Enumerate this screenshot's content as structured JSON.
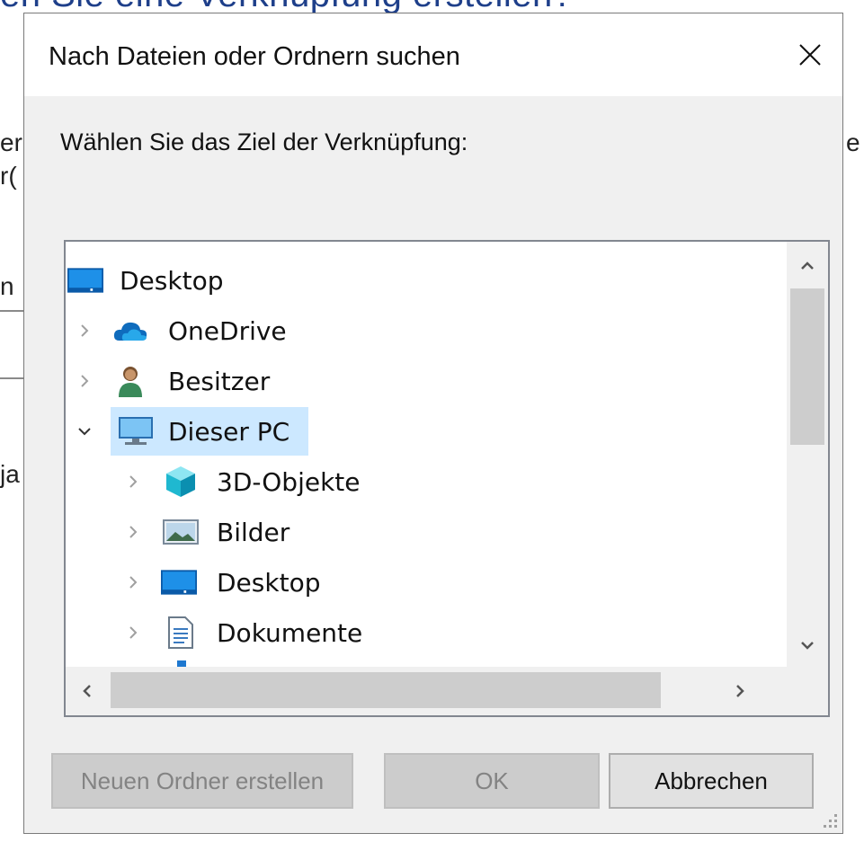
{
  "background": {
    "title_fragment": "en Sie eine Verknüpfung erstellen?",
    "frag_left": [
      "er",
      "r(",
      "n",
      "ja"
    ],
    "frag_right": "e"
  },
  "dialog": {
    "title": "Nach Dateien oder Ordnern suchen",
    "prompt": "Wählen Sie das Ziel der Verknüpfung:",
    "close_icon": "close-x-icon"
  },
  "tree": {
    "items": [
      {
        "label": "Desktop",
        "icon": "desktop-icon",
        "level": 0,
        "chevron": "none"
      },
      {
        "label": "OneDrive",
        "icon": "onedrive-cloud-icon",
        "level": 1,
        "chevron": "right"
      },
      {
        "label": "Besitzer",
        "icon": "user-icon",
        "level": 1,
        "chevron": "right"
      },
      {
        "label": "Dieser PC",
        "icon": "this-pc-icon",
        "level": 1,
        "chevron": "down",
        "selected": true
      },
      {
        "label": "3D-Objekte",
        "icon": "3d-objects-icon",
        "level": 2,
        "chevron": "right"
      },
      {
        "label": "Bilder",
        "icon": "pictures-icon",
        "level": 2,
        "chevron": "right"
      },
      {
        "label": "Desktop",
        "icon": "desktop-icon",
        "level": 2,
        "chevron": "right"
      },
      {
        "label": "Dokumente",
        "icon": "documents-icon",
        "level": 2,
        "chevron": "right"
      }
    ]
  },
  "buttons": {
    "new_folder": "Neuen Ordner erstellen",
    "ok": "OK",
    "cancel": "Abbrechen"
  },
  "colors": {
    "selection": "#cce8ff",
    "accent_blue": "#0078d7",
    "dialog_bg": "#f0f0f0"
  }
}
